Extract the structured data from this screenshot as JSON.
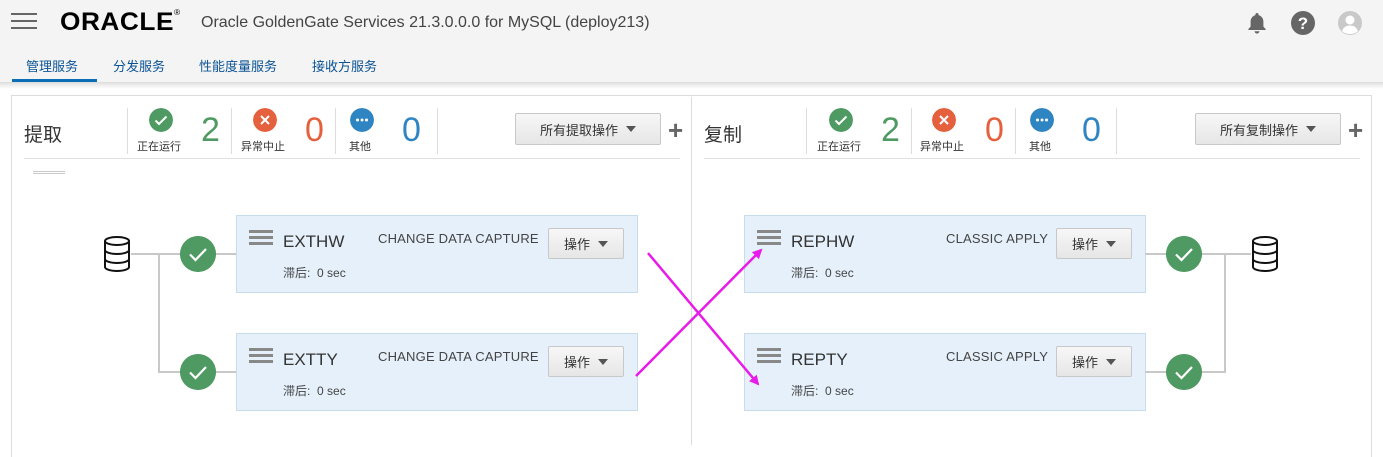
{
  "header": {
    "logo_text": "ORACLE",
    "title": "Oracle GoldenGate Services 21.3.0.0.0 for MySQL (deploy213)",
    "icons": [
      "menu-icon",
      "bell-icon",
      "help-icon",
      "user-icon"
    ]
  },
  "tabs": [
    {
      "label": "管理服务",
      "active": true
    },
    {
      "label": "分发服务",
      "active": false
    },
    {
      "label": "性能度量服务",
      "active": false
    },
    {
      "label": "接收方服务",
      "active": false
    }
  ],
  "extract": {
    "title": "提取",
    "stats": [
      {
        "label": "正在运行",
        "count": "2",
        "status": "running"
      },
      {
        "label": "异常中止",
        "count": "0",
        "status": "abended"
      },
      {
        "label": "其他",
        "count": "0",
        "status": "other"
      }
    ],
    "all_ops_label": "所有提取操作",
    "add_label": "+",
    "processes": [
      {
        "name": "EXTHW",
        "type": "CHANGE DATA CAPTURE",
        "lag_label": "滞后:",
        "lag_value": "0 sec",
        "ops_label": "操作"
      },
      {
        "name": "EXTTY",
        "type": "CHANGE DATA CAPTURE",
        "lag_label": "滞后:",
        "lag_value": "0 sec",
        "ops_label": "操作"
      }
    ]
  },
  "replicat": {
    "title": "复制",
    "stats": [
      {
        "label": "正在运行",
        "count": "2",
        "status": "running"
      },
      {
        "label": "异常中止",
        "count": "0",
        "status": "abended"
      },
      {
        "label": "其他",
        "count": "0",
        "status": "other"
      }
    ],
    "all_ops_label": "所有复制操作",
    "add_label": "+",
    "processes": [
      {
        "name": "REPHW",
        "type": "CLASSIC APPLY",
        "lag_label": "滞后:",
        "lag_value": "0 sec",
        "ops_label": "操作"
      },
      {
        "name": "REPTY",
        "type": "CLASSIC APPLY",
        "lag_label": "滞后:",
        "lag_value": "0 sec",
        "ops_label": "操作"
      }
    ]
  },
  "colors": {
    "running": "#4e9a62",
    "abended": "#e5603d",
    "other": "#2f84c2",
    "accent": "#0b6fb7",
    "annotation_arrow": "#e81ce8"
  }
}
